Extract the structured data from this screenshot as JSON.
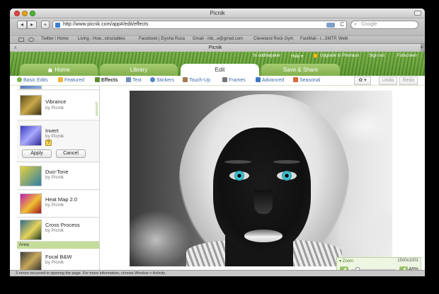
{
  "window": {
    "title": "Picnik"
  },
  "toolbar": {
    "back_label": "◂",
    "forward_label": "▸",
    "add_label": "+",
    "url": "http://www.picnik.com/app#/edit/effects",
    "reload_label": "C",
    "search_placeholder": "Google",
    "search_icon": "search-icon"
  },
  "bookmarks": [
    "Twitter / Home",
    "Living - How...structables",
    "Facebook | Elysha Roca",
    "Gmail - Inb...e@gmail.com",
    "Cleveland Rock Gym",
    "FastMail - r...SMTP, Webl"
  ],
  "tab": {
    "label": "Picnik",
    "close_label": "x",
    "new_label": "+"
  },
  "header": {
    "user_label": "hi oddharjaker",
    "help_label": "Help ▾",
    "upgrade_label": "Upgrade to Premium",
    "signout_label": "Sign out",
    "fullscreen_label": "Fullscreen",
    "main_tabs": [
      {
        "label": "Home"
      },
      {
        "label": "Library"
      },
      {
        "label": "Edit"
      },
      {
        "label": "Save & Share"
      }
    ]
  },
  "subbar": {
    "tabs": [
      {
        "label": "Basic Edits",
        "color": "#7ab648"
      },
      {
        "label": "Featured",
        "color": "#f2b53a"
      },
      {
        "label": "Effects",
        "color": "#5a8f2e"
      },
      {
        "label": "Text",
        "color": "#6d8fbd"
      },
      {
        "label": "Stickers",
        "color": "#4f86c8"
      },
      {
        "label": "Touch-Up",
        "color": "#a27a52"
      },
      {
        "label": "Frames",
        "color": "#777777"
      },
      {
        "label": "Advanced",
        "color": "#3e78c4"
      },
      {
        "label": "Seasonal",
        "color": "#d56a3b"
      }
    ],
    "settings_label": "✿ ▾",
    "undo_label": "Undo",
    "redo_label": "Redo"
  },
  "panel": {
    "effects": [
      {
        "name": "Vibrance",
        "by": "by Picnik"
      },
      {
        "name": "Invert",
        "by": "by Picnik"
      },
      {
        "name": "Duo-Tone",
        "by": "by Picnik"
      },
      {
        "name": "Heat Map 2.0",
        "by": "by Picnik"
      },
      {
        "name": "Cross Process",
        "by": "by Picnik"
      },
      {
        "name": "Focal B&W",
        "by": "by Picnik"
      }
    ],
    "premium_badge": "premium",
    "apply_label": "Apply",
    "cancel_label": "Cancel",
    "help_label": "?",
    "area_label": "Area"
  },
  "zoom": {
    "label": "▾ Zoom",
    "size": "1500x1001",
    "minus_label": "◢",
    "plus_label": "◢",
    "percent": "48%",
    "level": 0.1
  },
  "status": {
    "text": "3 errors occurred in opening the page. For more information, choose Window > Activity."
  }
}
